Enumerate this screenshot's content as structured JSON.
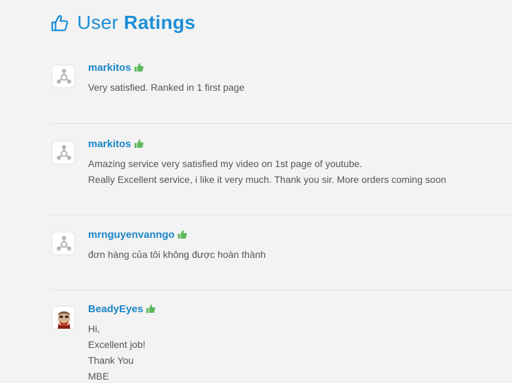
{
  "header": {
    "title_light": "User",
    "title_bold": "Ratings",
    "icon": "thumbs-up-icon"
  },
  "colors": {
    "accent": "#1d8fd8",
    "username": "#1a86c8",
    "positive": "#5cb85c",
    "text": "#555555",
    "background": "#f3f3f3",
    "divider": "#e0e0e0"
  },
  "reviews": [
    {
      "username": "markitos",
      "rating_icon": "thumbs-up-icon",
      "avatar": "default-avatar-icon",
      "lines": [
        "Very satisfied. Ranked in 1 first page"
      ]
    },
    {
      "username": "markitos",
      "rating_icon": "thumbs-up-icon",
      "avatar": "default-avatar-icon",
      "lines": [
        "Amazing service very satisfied my video on 1st page of youtube.",
        "Really Excellent service, i like it very much. Thank you sir. More orders coming soon"
      ]
    },
    {
      "username": "mrnguyenvanngo",
      "rating_icon": "thumbs-up-icon",
      "avatar": "default-avatar-icon",
      "lines": [
        "đơn hàng của tôi không được hoàn thành"
      ]
    },
    {
      "username": "BeadyEyes",
      "rating_icon": "thumbs-up-icon",
      "avatar": "user-photo-avatar",
      "lines": [
        "Hi,",
        "Excellent job!",
        "Thank You",
        "MBE"
      ]
    }
  ]
}
